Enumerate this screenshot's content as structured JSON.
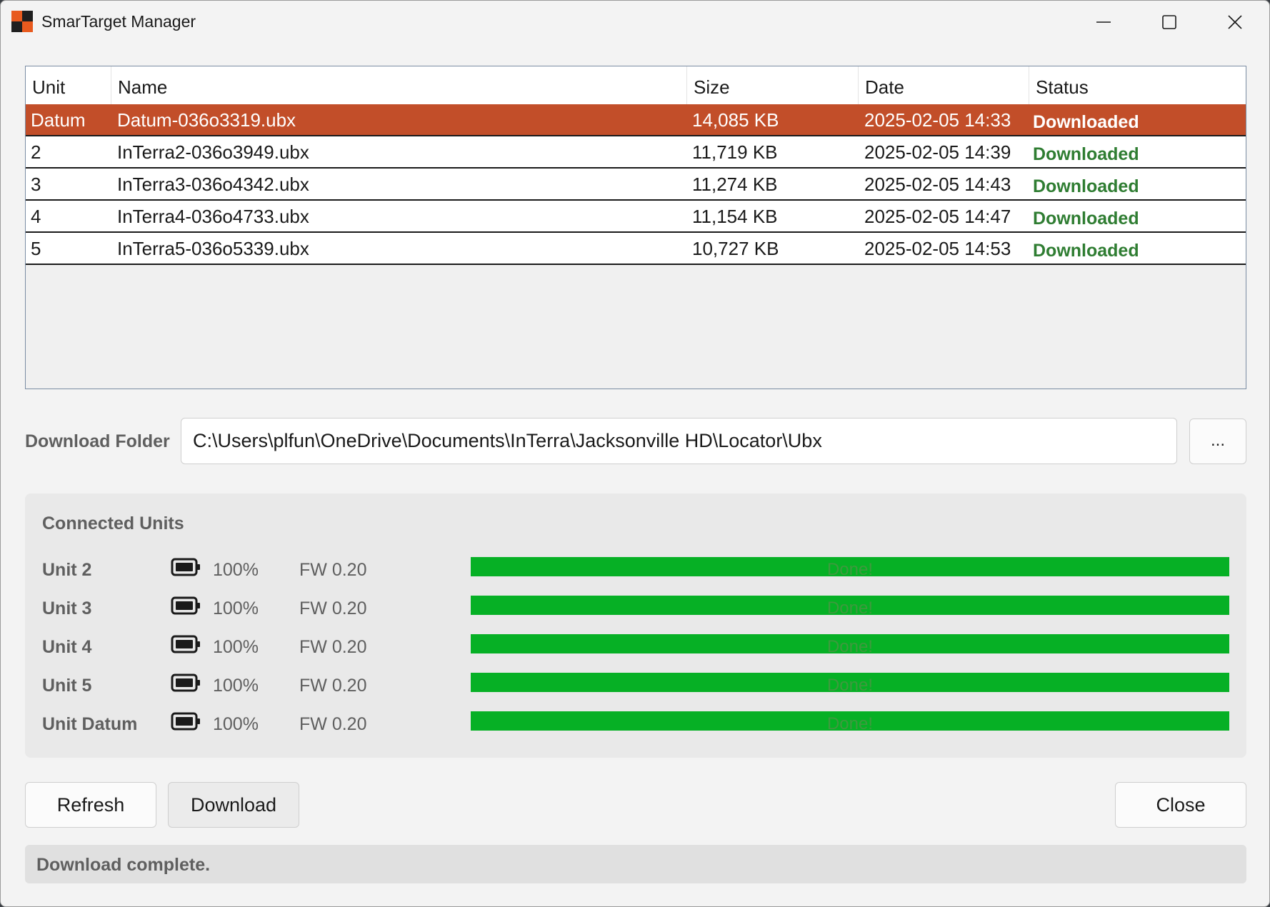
{
  "window": {
    "title": "SmarTarget Manager"
  },
  "colors": {
    "accent_selected_row": "#c24e29",
    "status_ok": "#2f7d32",
    "progress_fill": "#06b025"
  },
  "table": {
    "columns": [
      "Unit",
      "Name",
      "Size",
      "Date",
      "Status"
    ],
    "rows": [
      {
        "unit": "Datum",
        "name": "Datum-036o3319.ubx",
        "size": "14,085 KB",
        "date": "2025-02-05 14:33",
        "status": "Downloaded",
        "selected": true
      },
      {
        "unit": "2",
        "name": "InTerra2-036o3949.ubx",
        "size": "11,719 KB",
        "date": "2025-02-05 14:39",
        "status": "Downloaded"
      },
      {
        "unit": "3",
        "name": "InTerra3-036o4342.ubx",
        "size": "11,274 KB",
        "date": "2025-02-05 14:43",
        "status": "Downloaded"
      },
      {
        "unit": "4",
        "name": "InTerra4-036o4733.ubx",
        "size": "11,154 KB",
        "date": "2025-02-05 14:47",
        "status": "Downloaded"
      },
      {
        "unit": "5",
        "name": "InTerra5-036o5339.ubx",
        "size": "10,727 KB",
        "date": "2025-02-05 14:53",
        "status": "Downloaded"
      }
    ]
  },
  "download_folder": {
    "label": "Download Folder",
    "value": "C:\\Users\\plfun\\OneDrive\\Documents\\InTerra\\Jacksonville HD\\Locator\\Ubx",
    "browse_label": "..."
  },
  "connected_units": {
    "title": "Connected Units",
    "units": [
      {
        "name": "Unit 2",
        "battery": "100%",
        "firmware": "FW 0.20",
        "progress": 1.0,
        "progress_text": "Done!"
      },
      {
        "name": "Unit 3",
        "battery": "100%",
        "firmware": "FW 0.20",
        "progress": 1.0,
        "progress_text": "Done!"
      },
      {
        "name": "Unit 4",
        "battery": "100%",
        "firmware": "FW 0.20",
        "progress": 1.0,
        "progress_text": "Done!"
      },
      {
        "name": "Unit 5",
        "battery": "100%",
        "firmware": "FW 0.20",
        "progress": 1.0,
        "progress_text": "Done!"
      },
      {
        "name": "Unit Datum",
        "battery": "100%",
        "firmware": "FW 0.20",
        "progress": 1.0,
        "progress_text": "Done!"
      }
    ]
  },
  "buttons": {
    "refresh": "Refresh",
    "download": "Download",
    "close": "Close"
  },
  "status_bar": {
    "text": "Download complete."
  }
}
